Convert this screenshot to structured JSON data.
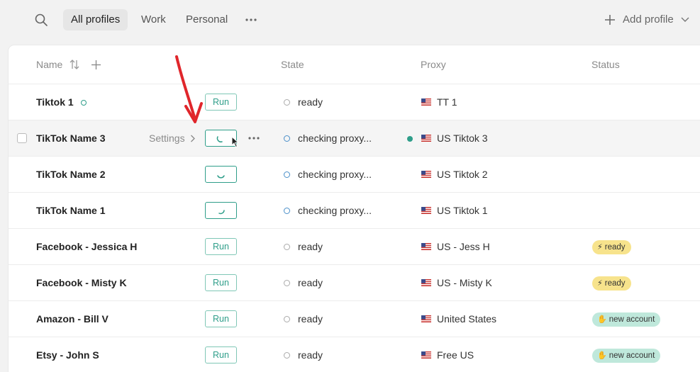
{
  "tabs": [
    {
      "label": "All profiles",
      "active": true
    },
    {
      "label": "Work",
      "active": false
    },
    {
      "label": "Personal",
      "active": false
    }
  ],
  "add_profile_label": "Add profile",
  "columns": {
    "name": "Name",
    "state": "State",
    "proxy": "Proxy",
    "status": "Status"
  },
  "settings_label": "Settings",
  "run_label": "Run",
  "colors": {
    "accent": "#2f9e8a",
    "ready_badge": "#f7e38c",
    "new_badge": "#bfe8db",
    "annotation_arrow": "#e0262b"
  },
  "rows": [
    {
      "name": "Tiktok 1",
      "online": true,
      "run": "Run",
      "state": "ready",
      "proxy": "TT 1",
      "status": ""
    },
    {
      "name": "TikTok Name 3",
      "hover": true,
      "run": "",
      "loading": true,
      "state": "checking proxy...",
      "proxy": "US Tiktok 3",
      "proxy_live": true,
      "status": ""
    },
    {
      "name": "TikTok Name 2",
      "run": "",
      "loading": true,
      "state": "checking proxy...",
      "proxy": "US Tiktok 2",
      "status": ""
    },
    {
      "name": "TikTok Name 1",
      "run": "",
      "loading": true,
      "state": "checking proxy...",
      "proxy": "US Tiktok 1",
      "status": ""
    },
    {
      "name": "Facebook - Jessica H",
      "run": "Run",
      "state": "ready",
      "proxy": "US - Jess H",
      "status": "ready",
      "status_type": "ready",
      "status_glyph": "⚡"
    },
    {
      "name": "Facebook - Misty K",
      "run": "Run",
      "state": "ready",
      "proxy": "US - Misty K",
      "status": "ready",
      "status_type": "ready",
      "status_glyph": "⚡"
    },
    {
      "name": "Amazon - Bill V",
      "run": "Run",
      "state": "ready",
      "proxy": "United States",
      "status": "new account",
      "status_type": "new",
      "status_glyph": "✋"
    },
    {
      "name": "Etsy - John S",
      "run": "Run",
      "state": "ready",
      "proxy": "Free US",
      "status": "new account",
      "status_type": "new",
      "status_glyph": "✋"
    }
  ]
}
